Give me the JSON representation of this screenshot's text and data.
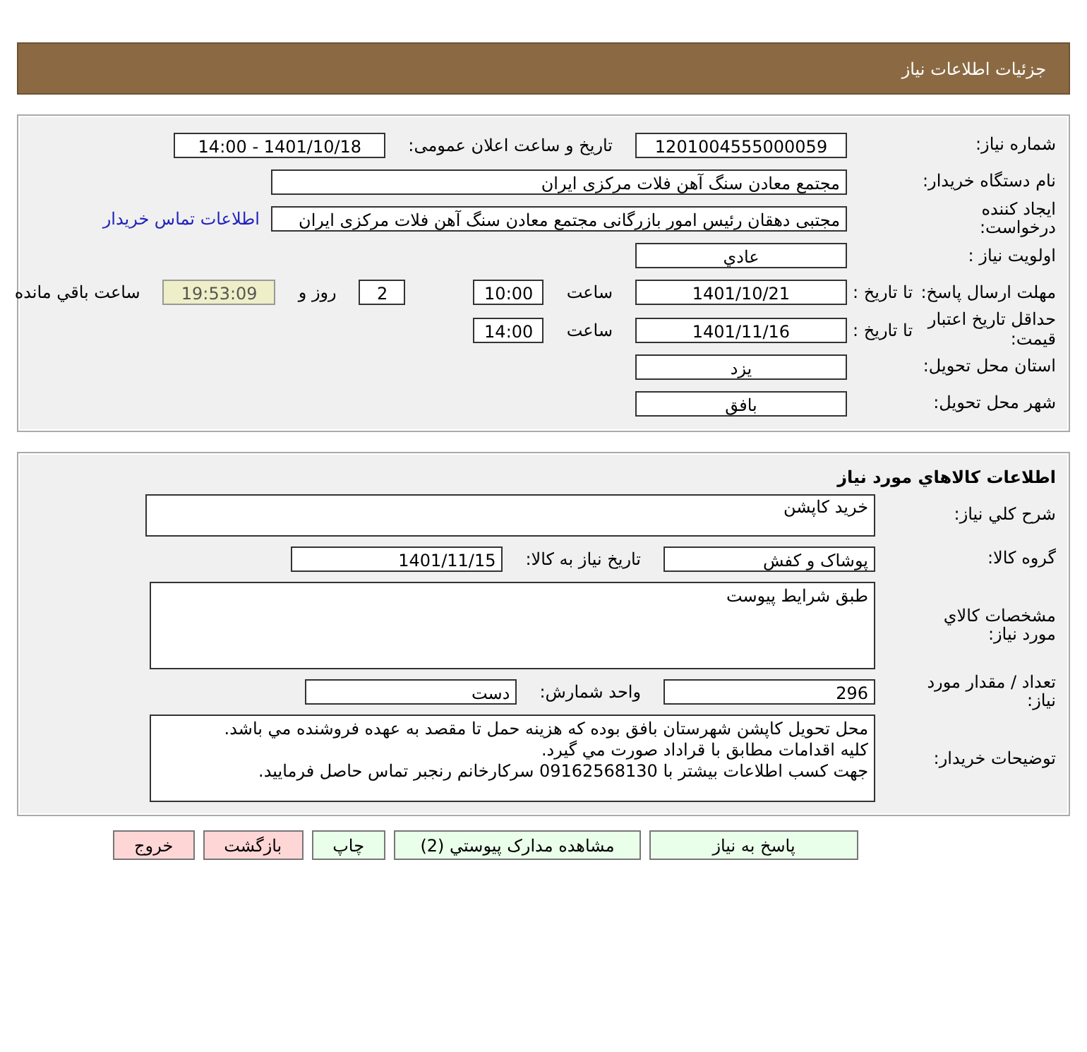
{
  "header": {
    "title": "جزئيات اطلاعات نياز"
  },
  "details": {
    "rows": [
      {
        "label": "شماره نیاز:",
        "items": [
          {
            "kind": "field",
            "text": "1201004555000059"
          },
          {
            "kind": "text",
            "text": "تاریخ و ساعت اعلان عمومی:"
          },
          {
            "kind": "field",
            "text": "1401/10/18 - 14:00"
          }
        ]
      },
      {
        "label": "نام دستگاه خریدار:",
        "items": [
          {
            "kind": "longfield",
            "text": "مجتمع معادن سنگ آهن فلات مرکزی ایران"
          }
        ]
      },
      {
        "label": "ایجاد کننده درخواست:",
        "items": [
          {
            "kind": "longfield",
            "text": "مجتبی  دهقان رئیس امور بازرگانی مجتمع معادن سنگ آهن فلات مرکزی ایران"
          },
          {
            "kind": "link",
            "text": "اطلاعات تماس خریدار"
          }
        ]
      },
      {
        "label": "اولویت نیاز :",
        "items": [
          {
            "kind": "field",
            "text": "عادي"
          }
        ]
      },
      {
        "label": "مهلت ارسال پاسخ:",
        "sublabel": "تا تاریخ :",
        "items": [
          {
            "kind": "field",
            "text": "1401/10/21"
          },
          {
            "kind": "text",
            "text": "ساعت"
          },
          {
            "kind": "shortfield",
            "text": "10:00"
          },
          {
            "kind": "tinyfield",
            "text": "2"
          },
          {
            "kind": "text",
            "text": "روز و"
          },
          {
            "kind": "timer",
            "text": "19:53:09"
          },
          {
            "kind": "text",
            "text": "ساعت باقي مانده"
          }
        ]
      },
      {
        "label": "حداقل تاریخ اعتبار قیمت:",
        "sublabel": "تا تاریخ :",
        "items": [
          {
            "kind": "field",
            "text": "1401/11/16"
          },
          {
            "kind": "text",
            "text": "ساعت"
          },
          {
            "kind": "shortfield",
            "text": "14:00"
          }
        ]
      },
      {
        "label": "استان محل تحویل:",
        "items": [
          {
            "kind": "field",
            "text": "یزد"
          }
        ]
      },
      {
        "label": "شهر محل تحویل:",
        "items": [
          {
            "kind": "field",
            "text": "بافق"
          }
        ]
      }
    ]
  },
  "goods": {
    "title": "اطلاعات کالاهاي مورد نياز",
    "rows": [
      {
        "label": "شرح کلي نياز:",
        "items": [
          {
            "kind": "box",
            "text": "خريد کاپشن"
          }
        ]
      },
      {
        "label": "گروه کالا:",
        "items": [
          {
            "kind": "field",
            "text": "پوشاک و کفش"
          },
          {
            "kind": "text",
            "text": "تاريخ نياز به کالا:"
          },
          {
            "kind": "field",
            "text": "1401/11/15"
          }
        ]
      },
      {
        "label": "مشخصات کالاي مورد نياز:",
        "items": [
          {
            "kind": "tallbox",
            "text": "طبق شرايط پيوست"
          }
        ]
      },
      {
        "label": "تعداد / مقدار مورد نياز:",
        "items": [
          {
            "kind": "field",
            "text": "296"
          },
          {
            "kind": "text",
            "text": "واحد شمارش:"
          },
          {
            "kind": "field",
            "text": "دست"
          }
        ]
      },
      {
        "label": "توضيحات خريدار:",
        "items": [
          {
            "kind": "tallbox",
            "lines": [
              "محل تحويل کاپشن شهرستان بافق بوده که هزينه حمل تا مقصد به عهده فروشنده مي باشد.",
              "کليه اقدامات مطابق با قراداد صورت مي گيرد.",
              "جهت کسب اطلاعات بيشتر با 09162568130 سرکارخانم رنجبر تماس حاصل فرماييد."
            ]
          }
        ]
      }
    ]
  },
  "buttons": [
    {
      "label": "پاسخ به نياز",
      "kind": "action"
    },
    {
      "label": "مشاهده مدارک پيوستي (2)",
      "kind": "action"
    },
    {
      "label": "چاپ",
      "kind": "action"
    },
    {
      "label": "بازگشت",
      "kind": "exit"
    },
    {
      "label": "خروج",
      "kind": "exit"
    }
  ]
}
